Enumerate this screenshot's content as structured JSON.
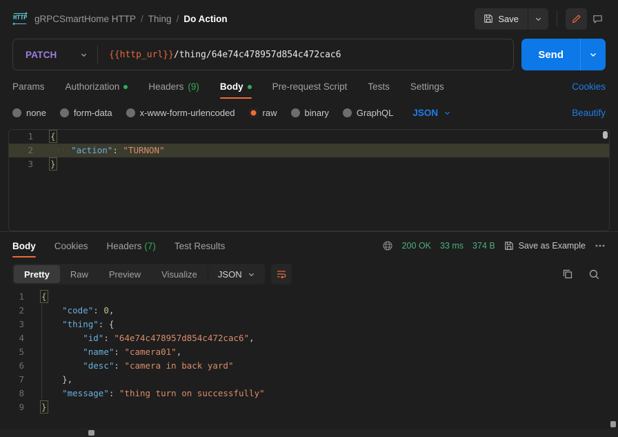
{
  "header": {
    "protocol_icon": "http-icon",
    "breadcrumb": [
      {
        "label": "gRPCSmartHome HTTP",
        "active": false
      },
      {
        "label": "Thing",
        "active": false
      },
      {
        "label": "Do Action",
        "active": true
      }
    ],
    "separator": "/",
    "save_label": "Save",
    "save_icon": "floppy-disk-icon",
    "save_caret_icon": "chevron-down-icon",
    "edit_icon": "pencil-icon",
    "comment_icon": "comment-icon",
    "accent_orange": "#ef6c33",
    "accent_blue": "#0d78e8"
  },
  "request": {
    "method": "PATCH",
    "method_caret_icon": "chevron-down-icon",
    "url_variable": "{{http_url}}",
    "url_path": "/thing/64e74c478957d854c472cac6",
    "url_full": "{{http_url}}/thing/64e74c478957d854c472cac6",
    "send_label": "Send",
    "send_caret_icon": "chevron-down-icon",
    "tabs": [
      {
        "label": "Params",
        "active": false,
        "dot": false,
        "count": ""
      },
      {
        "label": "Authorization",
        "active": false,
        "dot": true,
        "count": ""
      },
      {
        "label": "Headers",
        "active": false,
        "dot": false,
        "count": "(9)"
      },
      {
        "label": "Body",
        "active": true,
        "dot": true,
        "count": ""
      },
      {
        "label": "Pre-request Script",
        "active": false,
        "dot": false,
        "count": ""
      },
      {
        "label": "Tests",
        "active": false,
        "dot": false,
        "count": ""
      },
      {
        "label": "Settings",
        "active": false,
        "dot": false,
        "count": ""
      }
    ],
    "cookies_link": "Cookies",
    "body_types": [
      {
        "label": "none",
        "selected": false
      },
      {
        "label": "form-data",
        "selected": false
      },
      {
        "label": "x-www-form-urlencoded",
        "selected": false
      },
      {
        "label": "raw",
        "selected": true
      },
      {
        "label": "binary",
        "selected": false
      },
      {
        "label": "GraphQL",
        "selected": false
      }
    ],
    "format": "JSON",
    "format_caret_icon": "chevron-down-icon",
    "beautify_link": "Beautify",
    "editor_lines": [
      {
        "num": "1",
        "open": "{",
        "highlight": false
      },
      {
        "num": "2",
        "key": "\"action\"",
        "colon": ": ",
        "value": "\"TURNON\"",
        "highlight": true
      },
      {
        "num": "3",
        "close": "}",
        "highlight": false
      }
    ]
  },
  "response": {
    "tabs": [
      {
        "label": "Body",
        "active": true,
        "count": ""
      },
      {
        "label": "Cookies",
        "active": false,
        "count": ""
      },
      {
        "label": "Headers",
        "active": false,
        "count": "(7)"
      },
      {
        "label": "Test Results",
        "active": false,
        "count": ""
      }
    ],
    "network_icon": "globe-icon",
    "status": "200 OK",
    "time": "33 ms",
    "size": "374 B",
    "save_example_label": "Save as Example",
    "save_example_icon": "floppy-disk-icon",
    "more_icon": "ellipsis-icon",
    "view_modes": [
      {
        "label": "Pretty",
        "active": true
      },
      {
        "label": "Raw",
        "active": false
      },
      {
        "label": "Preview",
        "active": false
      },
      {
        "label": "Visualize",
        "active": false
      }
    ],
    "format": "JSON",
    "format_caret_icon": "chevron-down-icon",
    "wrap_icon": "word-wrap-icon",
    "copy_icon": "copy-icon",
    "search_icon": "search-icon",
    "body_lines": [
      {
        "num": "1",
        "indent": 0,
        "tokens": [
          {
            "t": "brace",
            "v": "{"
          }
        ]
      },
      {
        "num": "2",
        "indent": 1,
        "tokens": [
          {
            "t": "k",
            "v": "\"code\""
          },
          {
            "t": "p",
            "v": ": "
          },
          {
            "t": "n",
            "v": "0"
          },
          {
            "t": "p",
            "v": ","
          }
        ]
      },
      {
        "num": "3",
        "indent": 1,
        "tokens": [
          {
            "t": "k",
            "v": "\"thing\""
          },
          {
            "t": "p",
            "v": ": "
          },
          {
            "t": "p",
            "v": "{"
          }
        ]
      },
      {
        "num": "4",
        "indent": 2,
        "tokens": [
          {
            "t": "k",
            "v": "\"id\""
          },
          {
            "t": "p",
            "v": ": "
          },
          {
            "t": "s",
            "v": "\"64e74c478957d854c472cac6\""
          },
          {
            "t": "p",
            "v": ","
          }
        ]
      },
      {
        "num": "5",
        "indent": 2,
        "tokens": [
          {
            "t": "k",
            "v": "\"name\""
          },
          {
            "t": "p",
            "v": ": "
          },
          {
            "t": "s",
            "v": "\"camera01\""
          },
          {
            "t": "p",
            "v": ","
          }
        ]
      },
      {
        "num": "6",
        "indent": 2,
        "tokens": [
          {
            "t": "k",
            "v": "\"desc\""
          },
          {
            "t": "p",
            "v": ": "
          },
          {
            "t": "s",
            "v": "\"camera in back yard\""
          }
        ]
      },
      {
        "num": "7",
        "indent": 1,
        "tokens": [
          {
            "t": "p",
            "v": "},"
          }
        ]
      },
      {
        "num": "8",
        "indent": 1,
        "tokens": [
          {
            "t": "k",
            "v": "\"message\""
          },
          {
            "t": "p",
            "v": ": "
          },
          {
            "t": "s",
            "v": "\"thing turn on successfully\""
          }
        ]
      },
      {
        "num": "9",
        "indent": 0,
        "tokens": [
          {
            "t": "brace",
            "v": "}"
          }
        ]
      }
    ]
  }
}
